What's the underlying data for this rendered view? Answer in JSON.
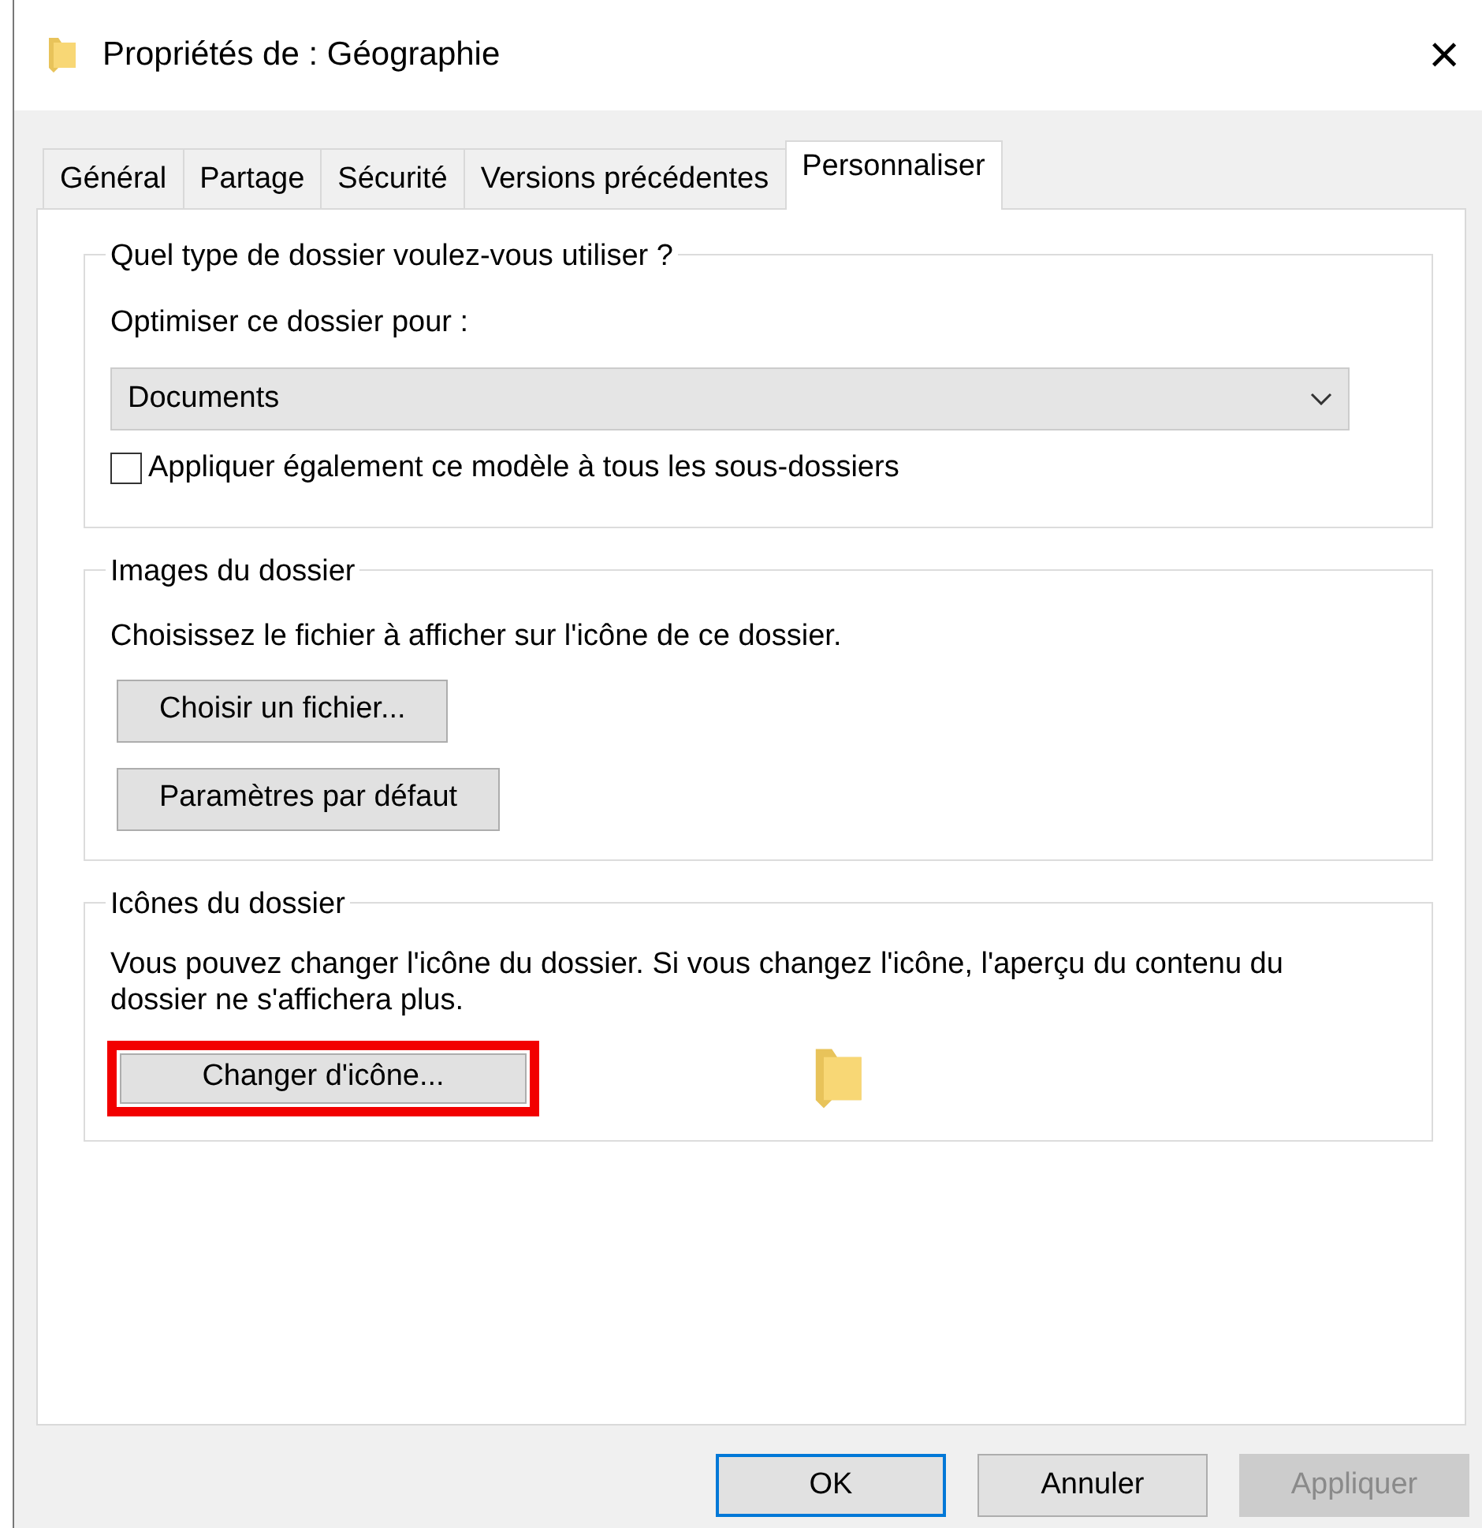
{
  "window": {
    "title": "Propriétés de : Géographie",
    "close": "×"
  },
  "tabs": [
    {
      "label": "Général",
      "selected": false
    },
    {
      "label": "Partage",
      "selected": false
    },
    {
      "label": "Sécurité",
      "selected": false
    },
    {
      "label": "Versions précédentes",
      "selected": false
    },
    {
      "label": "Personnaliser",
      "selected": true
    }
  ],
  "folder_type": {
    "legend": "Quel type de dossier voulez-vous utiliser ?",
    "label": "Optimiser ce dossier pour :",
    "dropdown": {
      "value": "Documents"
    },
    "checkbox": {
      "label": "Appliquer également ce modèle à tous les sous-dossiers",
      "checked": false
    }
  },
  "folder_pictures": {
    "legend": "Images du dossier",
    "text": "Choisissez le fichier à afficher sur l'icône de ce dossier.",
    "buttons": [
      {
        "label": "Choisir un fichier..."
      },
      {
        "label": "Paramètres par défaut"
      }
    ]
  },
  "folder_icons": {
    "legend": "Icônes du dossier",
    "text": "Vous pouvez changer l'icône du dossier. Si vous changez l'icône, l'aperçu du contenu du dossier ne s'affichera plus.",
    "button": {
      "label": "Changer d'icône...",
      "highlighted": true
    }
  },
  "footer_buttons": [
    {
      "label": "OK",
      "default": true,
      "disabled": false
    },
    {
      "label": "Annuler",
      "default": false,
      "disabled": false
    },
    {
      "label": "Appliquer",
      "default": false,
      "disabled": true
    }
  ]
}
